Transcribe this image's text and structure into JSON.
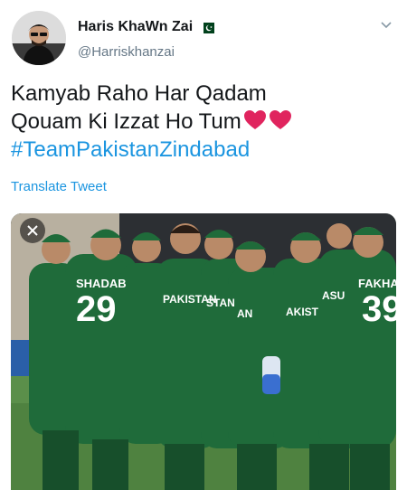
{
  "user": {
    "display_name": "Haris KhaWn Zai",
    "handle": "@Harriskhanzai",
    "flag_icon": "pakistan-flag-icon"
  },
  "tweet": {
    "line1": "Kamyab Raho Har Qadam",
    "line2": "Qouam Ki Izzat Ho Tum",
    "hashtag": "#TeamPakistanZindabad",
    "emoji": "two red hearts"
  },
  "translate_label": "Translate Tweet",
  "media": {
    "jerseys": [
      {
        "name": "SHADAB",
        "number": "29"
      },
      {
        "name": "PAKISTAN",
        "number": ""
      },
      {
        "name": "STAN",
        "number": ""
      },
      {
        "name": "AN",
        "number": ""
      },
      {
        "name": "AKIST",
        "number": ""
      },
      {
        "name": "ASU",
        "number": ""
      },
      {
        "name": "FAKHA",
        "number": "39"
      }
    ]
  },
  "colors": {
    "link": "#1b95e0",
    "heart": "#e0245e",
    "jersey": "#1f6b3a",
    "field": "#5b8f4a"
  }
}
